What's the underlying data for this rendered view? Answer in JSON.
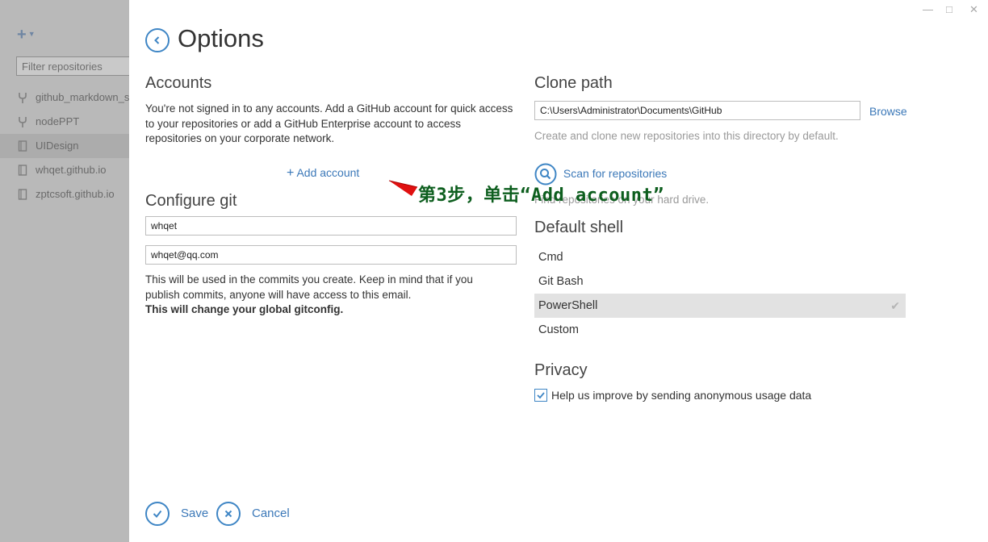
{
  "sidebar": {
    "add_icon": "plus-icon",
    "filter_placeholder": "Filter repositories",
    "repos": [
      {
        "name": "github_markdown_s",
        "icon": "fork-icon"
      },
      {
        "name": "nodePPT",
        "icon": "fork-icon"
      },
      {
        "name": "UIDesign",
        "icon": "repo-icon",
        "selected": true
      },
      {
        "name": "whqet.github.io",
        "icon": "repo-icon"
      },
      {
        "name": "zptcsoft.github.io",
        "icon": "repo-icon"
      }
    ]
  },
  "window_controls": [
    "minimize-icon",
    "maximize-icon",
    "close-icon"
  ],
  "page": {
    "title": "Options"
  },
  "accounts": {
    "title": "Accounts",
    "description": "You're not signed in to any accounts. Add a GitHub account for quick access to your repositories or add a GitHub Enterprise account to access repositories on your corporate network.",
    "add_account_label": "Add account"
  },
  "configure_git": {
    "title": "Configure git",
    "name_value": "whqet",
    "email_value": "whqet@qq.com",
    "note": "This will be used in the commits you create. Keep in mind that if you publish commits, anyone will have access to this email.",
    "note_bold": "This will change your global gitconfig."
  },
  "clone_path": {
    "title": "Clone path",
    "path_value": "C:\\Users\\Administrator\\Documents\\GitHub",
    "browse_label": "Browse",
    "hint": "Create and clone new repositories into this directory by default.",
    "scan_label": "Scan for repositories",
    "scan_hint": "Find repositories on your hard drive."
  },
  "default_shell": {
    "title": "Default shell",
    "options": [
      {
        "label": "Cmd",
        "selected": false
      },
      {
        "label": "Git Bash",
        "selected": false
      },
      {
        "label": "PowerShell",
        "selected": true
      },
      {
        "label": "Custom",
        "selected": false
      }
    ]
  },
  "privacy": {
    "title": "Privacy",
    "checkbox_label": "Help us improve by sending anonymous usage data",
    "checked": true
  },
  "footer": {
    "save_label": "Save",
    "cancel_label": "Cancel"
  },
  "annotation": {
    "text": "第3步，单击“Add account”",
    "color": "#0d5e1e",
    "arrow_color": "#e01010"
  },
  "colors": {
    "accent": "#3f86c5",
    "link": "#3b78b8",
    "sidebar_overlay": "#b9b9b9"
  }
}
